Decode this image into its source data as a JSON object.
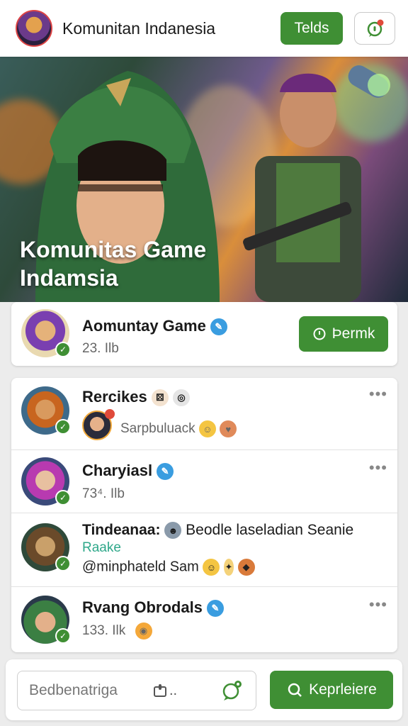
{
  "header": {
    "title": "Komunitan Indanesia",
    "action_label": "Telds",
    "chat_icon": "chat-notification-icon"
  },
  "hero": {
    "title_line1": "Komunitas Game",
    "title_line2": "Indamsia"
  },
  "group": {
    "name": "Aomuntay Game",
    "meta": "23.   Ilb",
    "join_label": "Þermk"
  },
  "members": [
    {
      "name": "Rercikes",
      "sub": "Sarpbuluack",
      "has_menu": true
    },
    {
      "name": "Charyiasl",
      "sub": "73⁴.   Ilb",
      "has_menu": true
    },
    {
      "name": "Tindeanaa:",
      "name_rest": "Beodle laseladian  Seanie",
      "tag": "Raake",
      "sub": "@minphateld Sam",
      "has_menu": false
    },
    {
      "name": "Rvang Obrodals",
      "sub": "133.   Ilk",
      "has_menu": true
    }
  ],
  "composer": {
    "placeholder": "Bedbenatriga",
    "send_label": "Keprleiere"
  },
  "colors": {
    "accent": "#3f8f34",
    "verified": "#3a9de0"
  }
}
